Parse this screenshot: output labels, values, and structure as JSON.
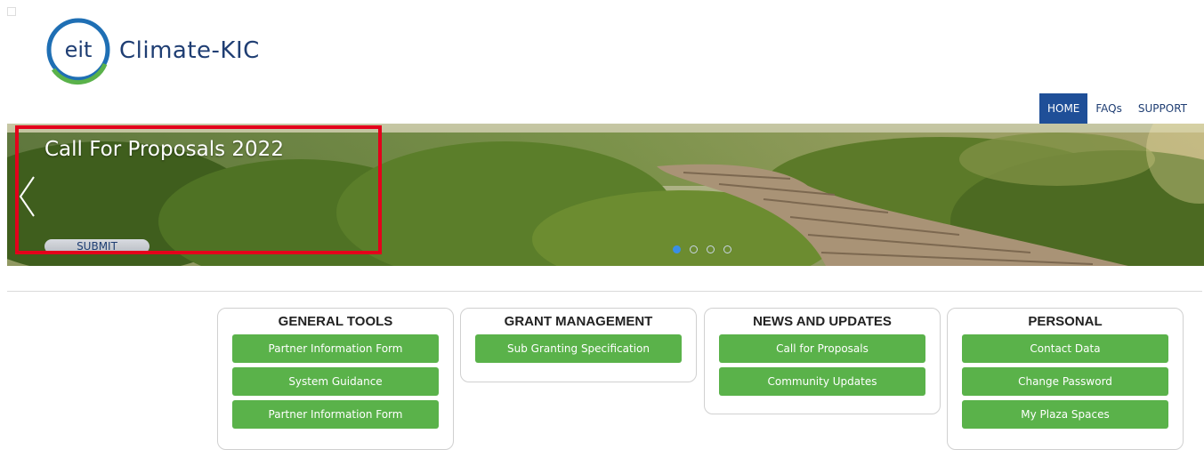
{
  "logo": {
    "emblem": "eit",
    "text": "Climate-KIC"
  },
  "nav": [
    {
      "label": "HOME"
    },
    {
      "label": "FAQs"
    },
    {
      "label": "SUPPORT"
    }
  ],
  "hero": {
    "title": "Call For Proposals 2022",
    "submit_label": "SUBMIT",
    "active_slide": 1,
    "slide_count": 4
  },
  "cards": [
    {
      "title": "GENERAL TOOLS",
      "buttons": [
        "Partner Information Form",
        "System Guidance",
        "Partner Information Form"
      ]
    },
    {
      "title": "GRANT MANAGEMENT",
      "buttons": [
        "Sub Granting Specification"
      ]
    },
    {
      "title": "NEWS AND UPDATES",
      "buttons": [
        "Call for Proposals",
        "Community Updates"
      ]
    },
    {
      "title": "PERSONAL",
      "buttons": [
        "Contact Data",
        "Change Password",
        "My Plaza Spaces"
      ]
    }
  ],
  "colors": {
    "brand_blue": "#1f3e73",
    "nav_active": "#1f4f98",
    "button_green": "#5ab24a",
    "highlight_red": "#e4001b"
  }
}
